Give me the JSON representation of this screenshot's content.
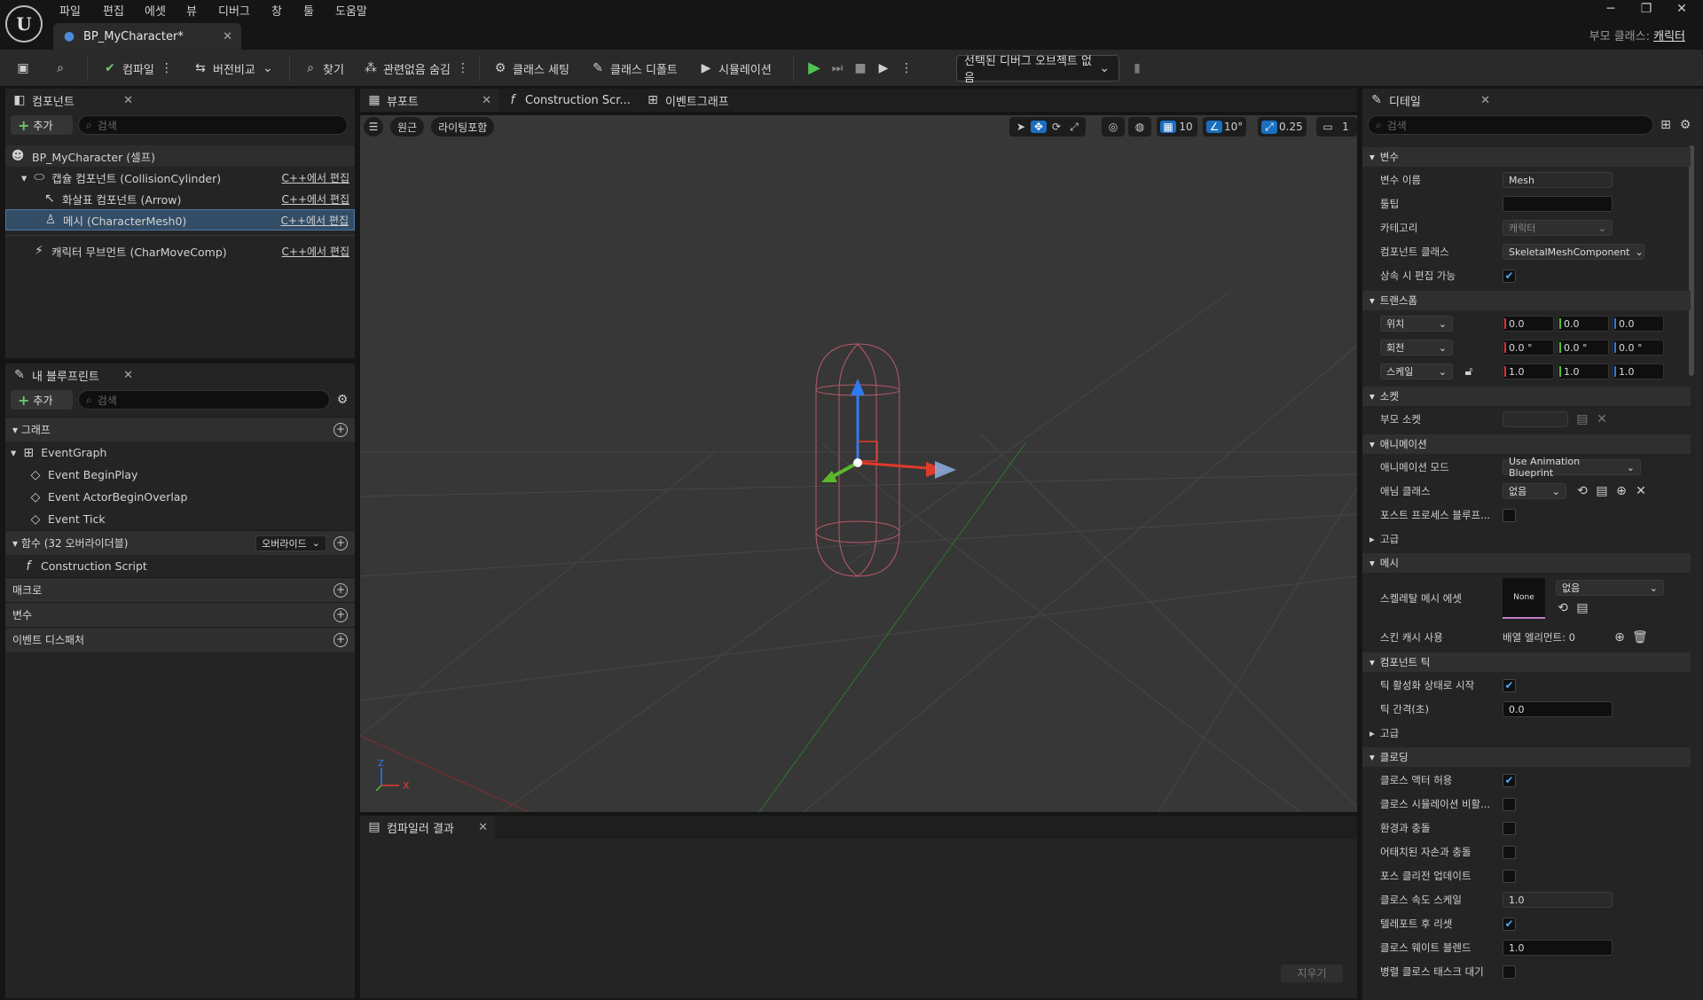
{
  "menu": [
    "파일",
    "편집",
    "에셋",
    "뷰",
    "디버그",
    "창",
    "툴",
    "도움말"
  ],
  "doc_tab": "BP_MyCharacter*",
  "parent_class": {
    "label": "부모 클래스:",
    "value": "캐릭터"
  },
  "window_controls": {
    "minimize": "─",
    "restore": "❐",
    "close": "✕"
  },
  "toolbar": {
    "compile": "컴파일",
    "diff": "버전비교",
    "find": "찾기",
    "hide_unrelated": "관련없음 숨김",
    "class_settings": "클래스 세팅",
    "class_defaults": "클래스 디폴트",
    "simulation": "시뮬레이션",
    "debug_object": "선택된 디버그 오브젝트 없음"
  },
  "components": {
    "tab": "컴포넌트",
    "add": "추가",
    "search_placeholder": "검색",
    "edit_cpp": "C++에서 편집",
    "items": [
      "BP_MyCharacter (셀프)",
      "캡슐 컴포넌트 (CollisionCylinder)",
      "화살표 컴포넌트 (Arrow)",
      "메시 (CharacterMesh0)",
      "캐릭터 무브먼트 (CharMoveComp)"
    ]
  },
  "my_blueprint": {
    "tab": "내 블루프린트",
    "add": "추가",
    "search_placeholder": "검색",
    "graph_section": "그래프",
    "event_graph": "EventGraph",
    "events": [
      "Event BeginPlay",
      "Event ActorBeginOverlap",
      "Event Tick"
    ],
    "functions_section": "함수 (32 오버라이더블)",
    "override": "오버라이드",
    "construction_script": "Construction Script",
    "macros": "매크로",
    "variables": "변수",
    "event_dispatchers": "이벤트 디스패처"
  },
  "center_tabs": [
    "뷰포트",
    "Construction Scr...",
    "이벤트그래프"
  ],
  "viewport": {
    "perspective": "원근",
    "lit": "라이팅포함",
    "grid_snap": "10",
    "rot_snap": "10°",
    "scale_snap": "0.25",
    "camera_speed": "1",
    "axis_x": "X",
    "axis_z": "Z"
  },
  "compiler": {
    "tab": "컴파일러 결과",
    "clear": "지우기"
  },
  "details": {
    "tab": "디테일",
    "search_placeholder": "검색",
    "sec_variable": "변수",
    "var_name_label": "변수 이름",
    "var_name": "Mesh",
    "tooltip_label": "툴팁",
    "category_label": "카테고리",
    "category": "캐릭터",
    "comp_class_label": "컴포넌트 클래스",
    "comp_class": "SkeletalMeshComponent",
    "editable_inherit": "상속 시 편집 가능",
    "sec_transform": "트랜스폼",
    "location": "위치",
    "rotation": "회전",
    "scale": "스케일",
    "loc_vals": [
      "0.0",
      "0.0",
      "0.0"
    ],
    "rot_vals": [
      "0.0 °",
      "0.0 °",
      "0.0 °"
    ],
    "scale_vals": [
      "1.0",
      "1.0",
      "1.0"
    ],
    "sec_sockets": "소켓",
    "parent_socket": "부모 소켓",
    "sec_animation": "애니메이션",
    "anim_mode_label": "애니메이션 모드",
    "anim_mode": "Use Animation Blueprint",
    "anim_class_label": "애님 클래스",
    "anim_class": "없음",
    "post_process": "포스트 프로세스 블루프...",
    "advanced": "고급",
    "sec_mesh": "메시",
    "skel_mesh_label": "스켈레탈 메시 에셋",
    "skel_thumb": "None",
    "skel_mesh": "없음",
    "skin_cache_label": "스킨 캐시 사용",
    "skin_cache": "배열 엘리먼트: 0",
    "sec_comp_tick": "컴포넌트 틱",
    "tick_start": "틱 활성화 상태로 시작",
    "tick_interval_label": "틱 간격(초)",
    "tick_interval": "0.0",
    "advanced2": "고급",
    "sec_cloth": "클로딩",
    "cloth_actor": "클로스 액터 허용",
    "cloth_sim_disable": "클로스 시뮬레이션 비활...",
    "collide_env": "환경과 충돌",
    "collide_attached": "어태치된 자손과 충돌",
    "force_update": "포스 클리전 업데이트",
    "cloth_speed_label": "클로스 속도 스케일",
    "cloth_speed": "1.0",
    "reset_teleport": "텔레포트 후 리셋",
    "cloth_blend_label": "클로스 웨이트 블렌드",
    "cloth_blend": "1.0",
    "parallel_wait": "병렬 클로스 태스크 대기"
  }
}
